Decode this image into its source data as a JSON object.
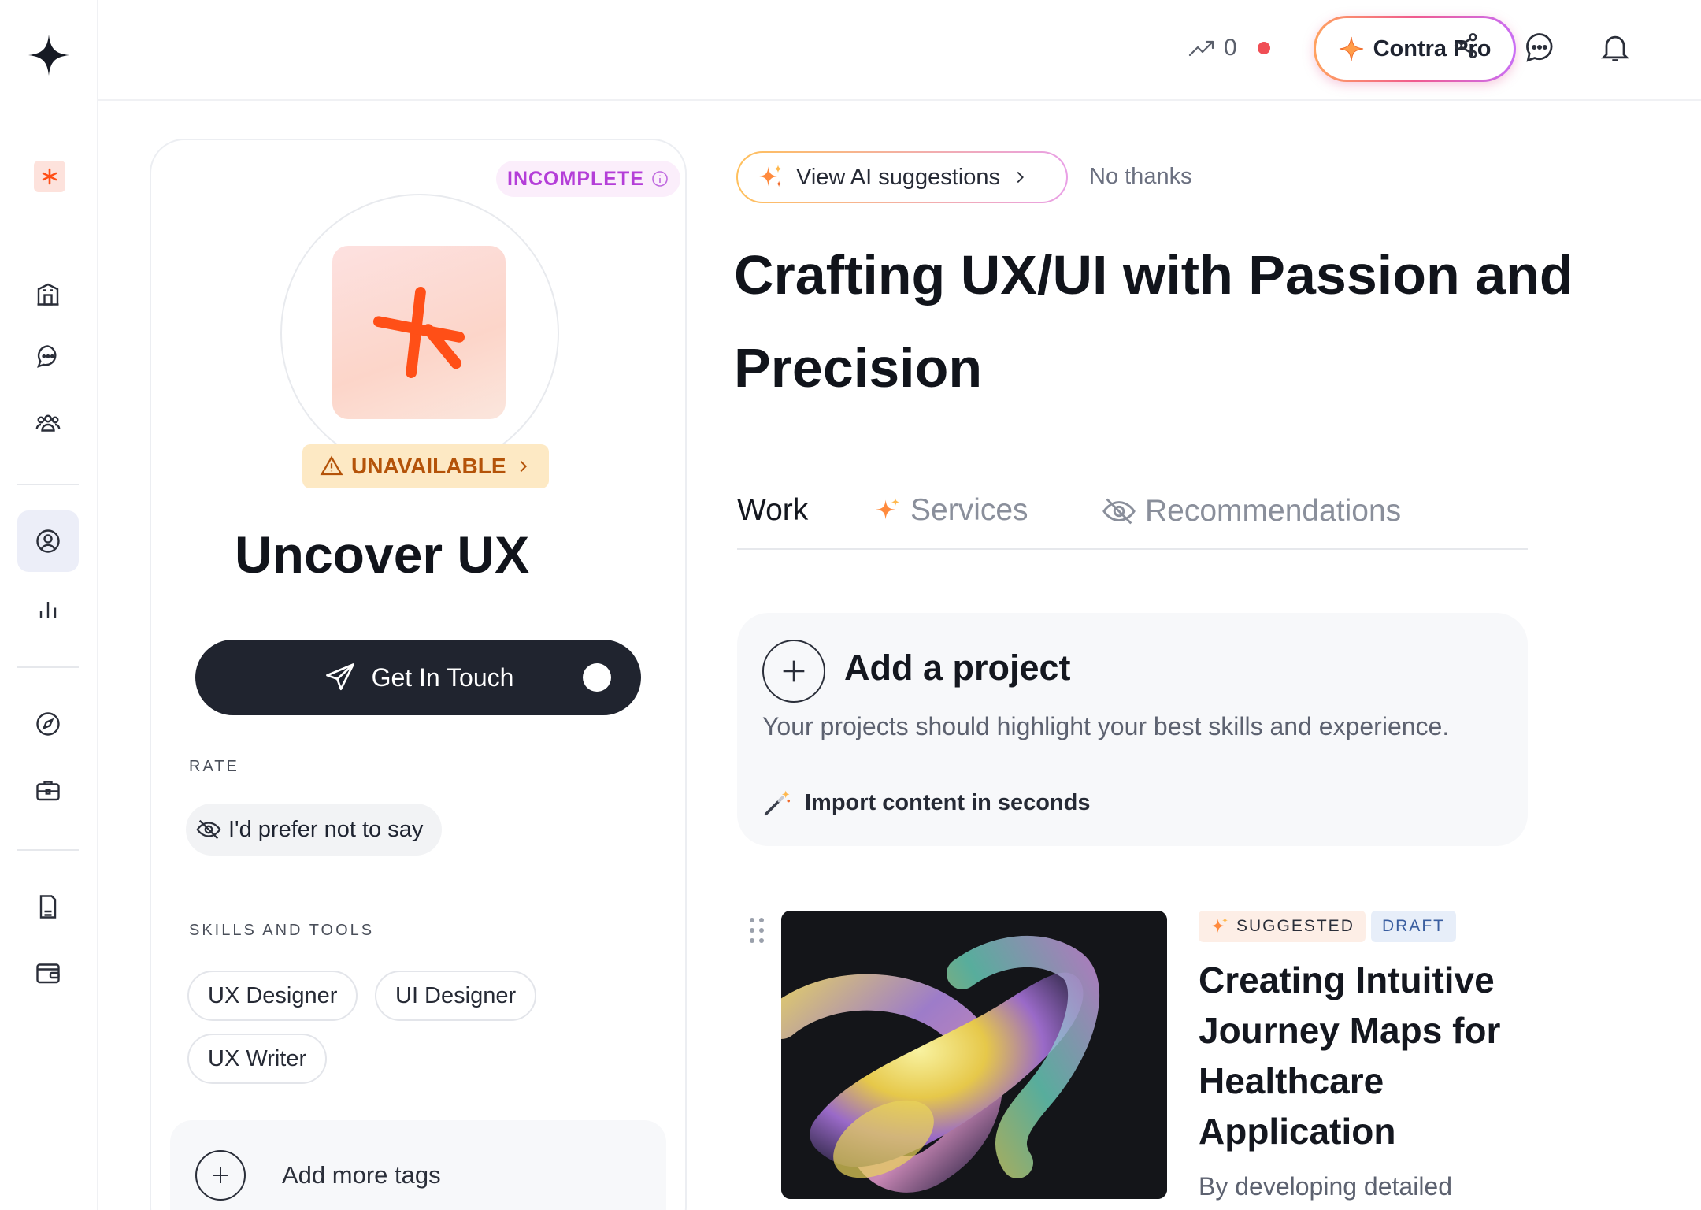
{
  "topbar": {
    "trend_count": "0",
    "pro_label": "Contra Pro"
  },
  "profile": {
    "status_badge": "INCOMPLETE",
    "availability": "UNAVAILABLE",
    "name": "Uncover UX",
    "cta_label": "Get In Touch",
    "rate_label": "RATE",
    "rate_value": "I'd prefer not to say",
    "skills_label": "SKILLS AND TOOLS",
    "skills": [
      "UX Designer",
      "UI Designer",
      "UX Writer"
    ],
    "add_tags_label": "Add more tags"
  },
  "main": {
    "ai_suggestions_label": "View AI suggestions",
    "no_thanks_label": "No thanks",
    "headline": "Crafting UX/UI with Passion and Precision",
    "tabs": [
      {
        "label": "Work"
      },
      {
        "label": "Services"
      },
      {
        "label": "Recommendations"
      }
    ],
    "add_project": {
      "title": "Add a project",
      "subtitle": "Your projects should highlight your best skills and experience.",
      "import_label": "Import content in seconds"
    },
    "project": {
      "badge_suggested": "SUGGESTED",
      "badge_draft": "DRAFT",
      "title": "Creating Intuitive Journey Maps for Healthcare Application",
      "description": "By developing detailed"
    }
  },
  "colors": {
    "accent_orange": "#ff4f17",
    "incomplete_purple": "#b43ed8",
    "unavailable_amber": "#b45309",
    "button_dark": "#20242f"
  }
}
